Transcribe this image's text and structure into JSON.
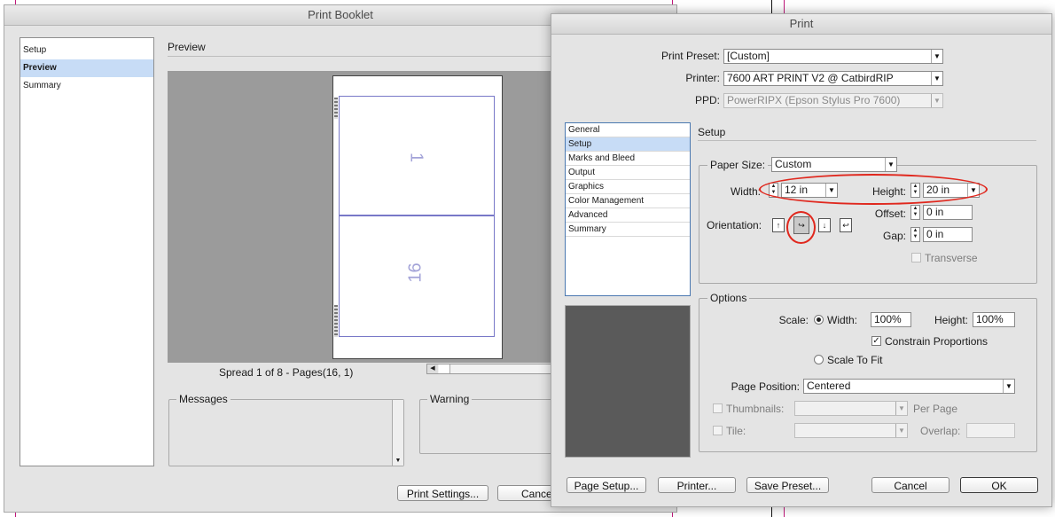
{
  "booklet": {
    "title": "Print Booklet",
    "nav": [
      {
        "label": "Setup",
        "selected": false
      },
      {
        "label": "Preview",
        "selected": true
      },
      {
        "label": "Summary",
        "selected": false
      }
    ],
    "preview_heading": "Preview",
    "page_numbers": [
      "1",
      "16"
    ],
    "spread_info": "Spread 1 of 8 - Pages(16, 1)",
    "messages_label": "Messages",
    "warning_label": "Warning",
    "print_settings_btn": "Print Settings...",
    "cancel_btn": "Cancel"
  },
  "print": {
    "title": "Print",
    "preset_label": "Print Preset:",
    "preset_value": "[Custom]",
    "printer_label": "Printer:",
    "printer_value": "7600 ART PRINT V2 @ CatbirdRIP",
    "ppd_label": "PPD:",
    "ppd_value": "PowerRIPX (Epson Stylus Pro 7600)",
    "nav": [
      {
        "label": "General",
        "selected": false
      },
      {
        "label": "Setup",
        "selected": true
      },
      {
        "label": "Marks and Bleed",
        "selected": false
      },
      {
        "label": "Output",
        "selected": false
      },
      {
        "label": "Graphics",
        "selected": false
      },
      {
        "label": "Color Management",
        "selected": false
      },
      {
        "label": "Advanced",
        "selected": false
      },
      {
        "label": "Summary",
        "selected": false
      }
    ],
    "section_heading": "Setup",
    "paper_size_label": "Paper Size:",
    "paper_size_value": "Custom",
    "width_label": "Width:",
    "width_value": "12 in",
    "height_label": "Height:",
    "height_value": "20 in",
    "offset_label": "Offset:",
    "offset_value": "0 in",
    "gap_label": "Gap:",
    "gap_value": "0 in",
    "orientation_label": "Orientation:",
    "transverse_label": "Transverse",
    "options_label": "Options",
    "scale_label": "Scale:",
    "scale_width_label": "Width:",
    "scale_width_value": "100%",
    "scale_height_label": "Height:",
    "scale_height_value": "100%",
    "constrain_label": "Constrain Proportions",
    "scale_to_fit_label": "Scale To Fit",
    "page_position_label": "Page Position:",
    "page_position_value": "Centered",
    "thumbnails_label": "Thumbnails:",
    "per_page_label": "Per Page",
    "tile_label": "Tile:",
    "overlap_label": "Overlap:",
    "page_setup_btn": "Page Setup...",
    "printer_btn": "Printer...",
    "save_preset_btn": "Save Preset...",
    "cancel_btn": "Cancel",
    "ok_btn": "OK"
  },
  "colors": {
    "annotation": "#e0281e",
    "guide": "#c0177a",
    "selection": "#c7dcf6"
  }
}
